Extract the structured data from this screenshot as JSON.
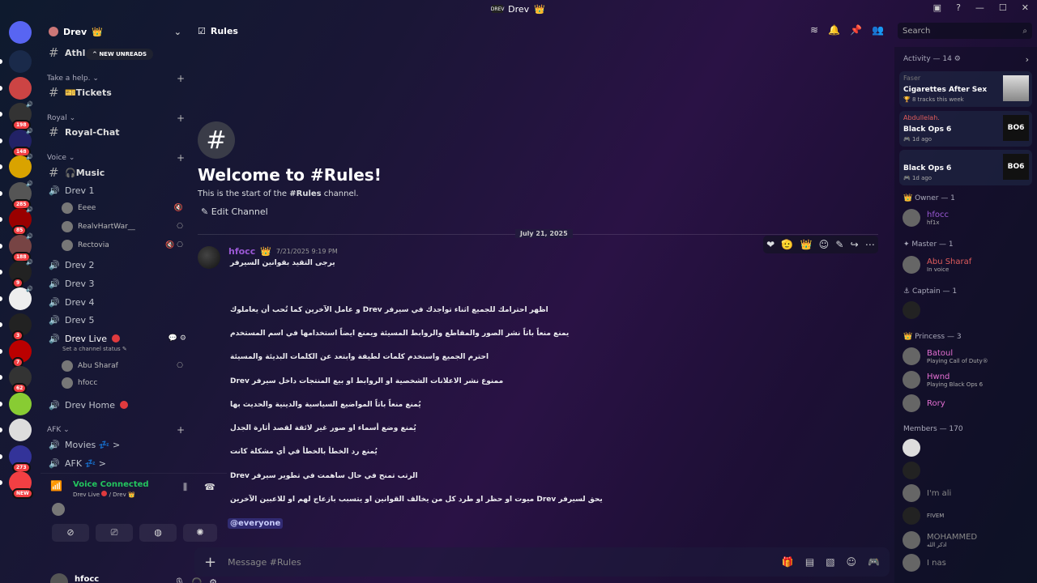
{
  "titlebar": {
    "title": "Drev",
    "logo": "DREV"
  },
  "guilds": [
    {
      "badge": "",
      "sp": ""
    },
    {
      "badge": "",
      "sp": ""
    },
    {
      "badge": "198",
      "sp": "🔊"
    },
    {
      "badge": "148",
      "sp": "🔊"
    },
    {
      "badge": "",
      "sp": "🔊"
    },
    {
      "badge": "285",
      "sp": "🔊"
    },
    {
      "badge": "85",
      "sp": "🔊"
    },
    {
      "badge": "188",
      "sp": "🔊"
    },
    {
      "badge": "9",
      "sp": "🔊"
    },
    {
      "badge": "",
      "sp": "🔊"
    },
    {
      "badge": "3",
      "sp": ""
    },
    {
      "badge": "7",
      "sp": ""
    },
    {
      "badge": "62",
      "sp": ""
    },
    {
      "badge": "",
      "sp": ""
    },
    {
      "badge": "",
      "sp": ""
    },
    {
      "badge": "273",
      "sp": ""
    },
    {
      "badge": "NEW",
      "sp": ""
    }
  ],
  "server": {
    "name": "Drev"
  },
  "new_unreads": "NEW UNREADS",
  "channels": {
    "athl": "Athl",
    "cat_help": "Take a help.",
    "tickets": "🎫Tickets",
    "cat_royal": "Royal",
    "royal_chat": "Royal-Chat",
    "cat_voice": "Voice",
    "music": "🎧Music",
    "drev1": "Drev 1",
    "drev1_users": [
      "Eeee",
      "RealvHartWar__",
      "Rectovia"
    ],
    "drev2": "Drev 2",
    "drev3": "Drev 3",
    "drev4": "Drev 4",
    "drev5": "Drev 5",
    "drev_live": "Drev Live",
    "set_status": "Set a channel status",
    "live_users": [
      "Abu Sharaf",
      "hfocc"
    ],
    "drev_home": "Drev Home",
    "cat_afk": "AFK",
    "movies": "Movies 💤 >",
    "afk": "AFK 💤 >"
  },
  "voice": {
    "title": "Voice Connected",
    "sub": "Drev Live",
    "sub2": "/ Drev"
  },
  "user": {
    "name": "hfocc",
    "sub": "hf1x"
  },
  "topbar": {
    "channel": "Rules"
  },
  "search": {
    "placeholder": "Search"
  },
  "welcome": {
    "title": "Welcome to #Rules!",
    "sub_pre": "This is the start of the ",
    "sub_bold": "#Rules",
    "sub_post": " channel.",
    "edit": "Edit Channel"
  },
  "divider": "July 21, 2025",
  "message": {
    "author": "hfocc",
    "time": "7/21/2025 9:19 PM",
    "lines": [
      "يرجى التقيد بقوانين السيرفر",
      "اظهر احترامك للجميع اثناء تواجدك في سيرفر Drev و عامل الآخرين كما تُحب أن يعاملوك",
      "يمنع منعاً باتاً نشر الصور والمقاطع والروابط المسيئة ويمنع ايضاً استخدامها في اسم المستخدم",
      "احترم الجميع واستخدم كلمات لطيفة وابتعد عن الكلمات البذيئة والمسيئة",
      "ممنوع نشر الاعلانات الشخصية او الروابط او بيع المنتجات داخل سيرفر Drev",
      "يُمنع منعاً باتاً المواضيع السياسية والدينية والحديث بها",
      "يُمنع وضع أسماء او صور غير لائقة لقصد أثارة الجدل",
      "يُمنع رد الخطأ بالخطأ في أي مشكلة كانت",
      "الرتب تمنح في حال ساهمت في تطوير سيرفر Drev",
      "يحق لسيرفر Drev ميوت او حظر او طرد كل من يخالف القوانين او يتسبب بازعاج لهم او للاعبين الآخرين"
    ],
    "mention": "@everyone"
  },
  "composer": {
    "placeholder": "Message #Rules"
  },
  "activity": {
    "header": "Activity — 14",
    "items": [
      {
        "name": "Faser",
        "title": "Cigarettes After Sex",
        "sub": "8 tracks this week",
        "art": ""
      },
      {
        "name": "Abdullelah.",
        "title": "Black Ops 6",
        "sub": "1d ago",
        "art": "BO6"
      },
      {
        "name": "",
        "title": "Black Ops 6",
        "sub": "1d ago",
        "art": "BO6"
      }
    ]
  },
  "roles": {
    "owner": "Owner — 1",
    "owner_name": "hfocc",
    "owner_sub": "hf1x",
    "master": "Master — 1",
    "master_name": "Abu Sharaf",
    "master_sub": "In voice",
    "captain": "Captain — 1",
    "princess": "Princess — 3",
    "princess_members": [
      {
        "name": "Batoul",
        "sub": "Playing Call of Duty®",
        "color": "#e46fd3"
      },
      {
        "name": "Hwnd",
        "sub": "Playing Black Ops 6",
        "color": "#e46fd3"
      },
      {
        "name": "Rory",
        "sub": "",
        "color": "#e46fd3"
      }
    ],
    "members": "Members — 170",
    "member_list": [
      {
        "name": "",
        "sub": ""
      },
      {
        "name": "",
        "sub": ""
      },
      {
        "name": "I'm ali",
        "sub": ""
      },
      {
        "name": "",
        "sub": "FIVEM"
      },
      {
        "name": "MOHAMMED",
        "sub": "اذكر الله"
      },
      {
        "name": "I nas",
        "sub": ""
      }
    ]
  },
  "colors": {
    "accent": "#5865f2",
    "danger": "#f23f43",
    "role_pink": "#e46fd3"
  }
}
